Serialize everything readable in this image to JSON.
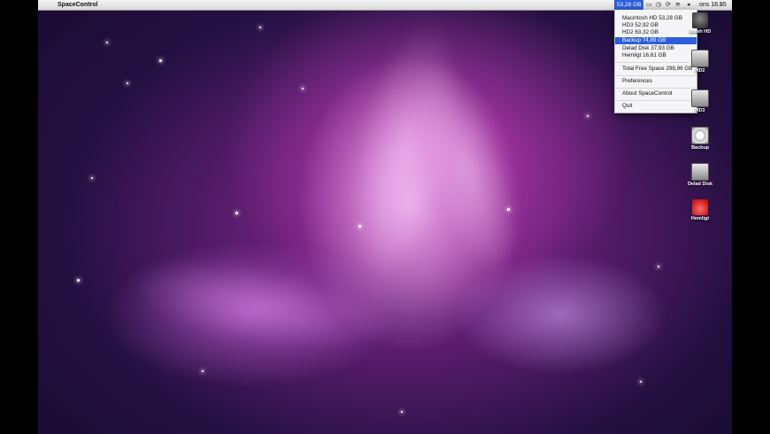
{
  "menubar": {
    "app_name": "SpaceControl",
    "apple_glyph": "",
    "status_item": "53,28 GB",
    "clock": "ons 18.55",
    "spotlight_glyph": "⌕"
  },
  "menu": {
    "disks": [
      "Macintosh HD 53,28 GB",
      "HD3 52,92 GB",
      "HD2 63,32 GB",
      "Backup 74,89 GB",
      "Delad Disk 37,93 GB",
      "Hemligt 16,61 GB"
    ],
    "selected_index": 3,
    "total": "Total Free Space 298,96 GB",
    "preferences": "Preferences",
    "about": "About SpaceControl",
    "quit": "Quit"
  },
  "desktop": {
    "icons": [
      {
        "label": "ntosh HD",
        "icon": "hard-drive-icon"
      },
      {
        "label": "HD2",
        "icon": "drive-icon"
      },
      {
        "label": "HD3",
        "icon": "drive-icon"
      },
      {
        "label": "Backup",
        "icon": "time-machine-icon"
      },
      {
        "label": "Delad Disk",
        "icon": "shared-disk-icon"
      },
      {
        "label": "Hemligt",
        "icon": "lock-icon"
      }
    ]
  },
  "colors": {
    "selection": "#2d5fdc",
    "menubar": "#e6e6e6"
  }
}
